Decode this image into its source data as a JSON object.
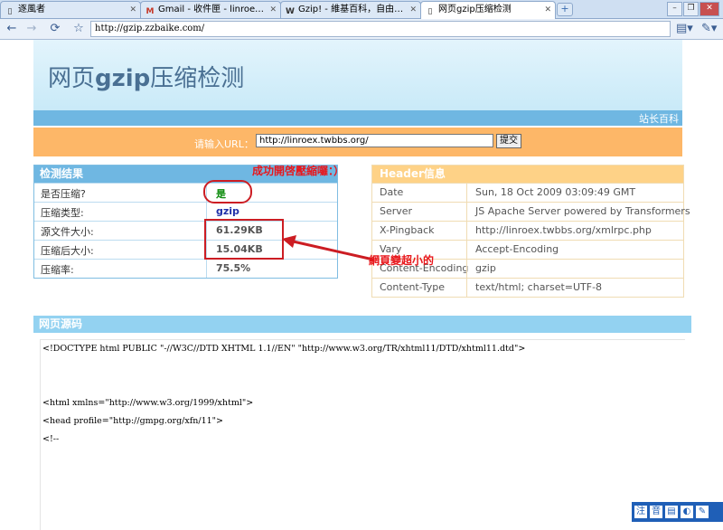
{
  "browser": {
    "tabs": [
      {
        "label": "逐風者",
        "icon": "page-icon"
      },
      {
        "label": "Gmail - 收件匣 - linroex@g...",
        "icon": "gmail-icon"
      },
      {
        "label": "Gzip! - 維基百科，自由的...",
        "icon": "wikipedia-icon"
      },
      {
        "label": "网页gzip压缩检测",
        "icon": "page-icon"
      }
    ],
    "address": "http://gzip.zzbaike.com/"
  },
  "page": {
    "title_prefix": "网页",
    "title_bold": "gzip",
    "title_suffix": "压缩检测",
    "site_link": "站长百科",
    "url_label": "请输入URL：",
    "url_value": "http://linroex.twbbs.org/",
    "submit_label": "提交"
  },
  "results": {
    "heading": "检测结果",
    "rows": [
      {
        "key": "是否压缩?",
        "value": "是",
        "color": "#0a8a0a"
      },
      {
        "key": "压缩类型:",
        "value": "gzip",
        "color": "#1f2fa8"
      },
      {
        "key": "源文件大小:",
        "value": "61.29KB",
        "color": "#555555"
      },
      {
        "key": "压缩后大小:",
        "value": "15.04KB",
        "color": "#555555"
      },
      {
        "key": "压缩率:",
        "value": "75.5%",
        "color": "#555555"
      }
    ]
  },
  "headers": {
    "heading": "Header信息",
    "rows": [
      {
        "key": "Date",
        "value": "Sun, 18 Oct 2009 03:09:49 GMT"
      },
      {
        "key": "Server",
        "value": "JS Apache Server powered by Transformers"
      },
      {
        "key": "X-Pingback",
        "value": "http://linroex.twbbs.org/xmlrpc.php"
      },
      {
        "key": "Vary",
        "value": "Accept-Encoding"
      },
      {
        "key": "Content-Encoding",
        "value": "gzip"
      },
      {
        "key": "Content-Type",
        "value": "text/html; charset=UTF-8"
      }
    ]
  },
  "annotations": {
    "success": "成功開啓壓縮囉：）",
    "smaller": "網頁變超小的"
  },
  "source": {
    "heading": "网页源码",
    "lines": [
      "<!DOCTYPE html PUBLIC \"-//W3C//DTD XHTML 1.1//EN\" \"http://www.w3.org/TR/xhtml11/DTD/xhtml11.dtd\">",
      "<html xmlns=\"http://www.w3.org/1999/xhtml\">",
      "<head profile=\"http://gmpg.org/xfn/11\">",
      "<!--"
    ]
  },
  "tray": {
    "icons": [
      "ime-icon",
      "keyboard-icon",
      "notebook-icon",
      "volume-icon",
      "network-icon"
    ],
    "glyphs": [
      "注",
      "音",
      "▤",
      "◐",
      "✎"
    ]
  }
}
